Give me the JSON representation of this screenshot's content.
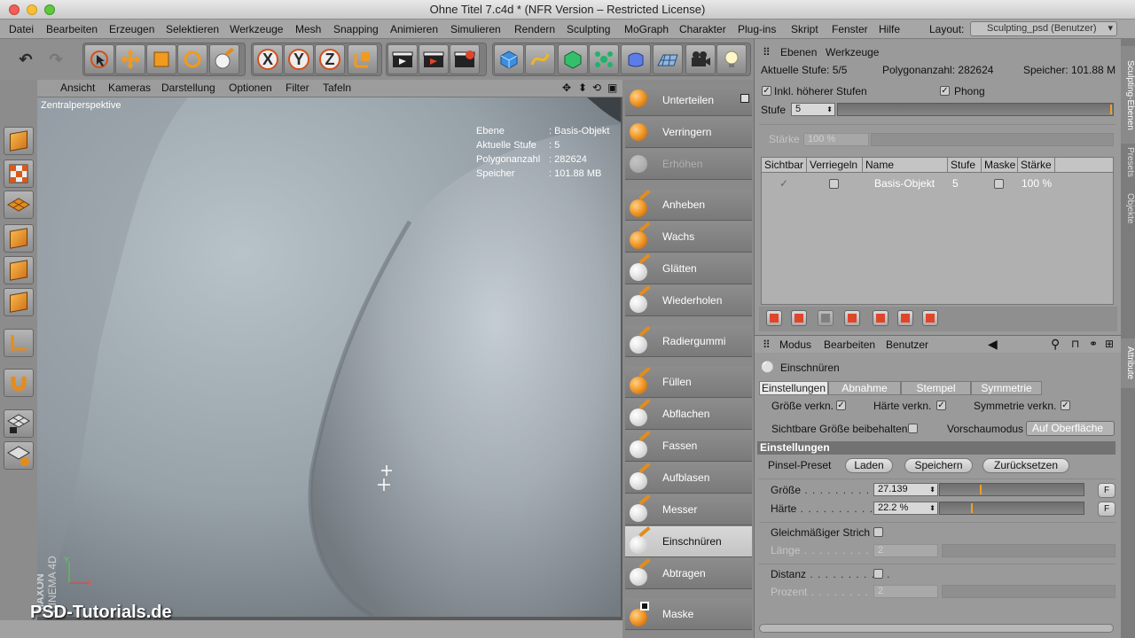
{
  "window": {
    "title": "Ohne Titel 7.c4d * (NFR Version – Restricted License)"
  },
  "menubar": {
    "items": [
      "Datei",
      "Bearbeiten",
      "Erzeugen",
      "Selektieren",
      "Werkzeuge",
      "Mesh",
      "Snapping",
      "Animieren",
      "Simulieren",
      "Rendern",
      "Sculpting",
      "MoGraph",
      "Charakter",
      "Plug-ins",
      "Skript",
      "Fenster",
      "Hilfe"
    ],
    "layout_label": "Layout:",
    "layout_value": "Sculpting_psd (Benutzer)"
  },
  "toolbar": {
    "axis_x": "X",
    "axis_y": "Y",
    "axis_z": "Z"
  },
  "viewport": {
    "menu": [
      "Ansicht",
      "Kameras",
      "Darstellung",
      "Optionen",
      "Filter",
      "Tafeln"
    ],
    "camera_label": "Zentralperspektive",
    "hud": {
      "ebene_k": "Ebene",
      "ebene_v": ": Basis-Objekt",
      "stufe_k": "Aktuelle Stufe",
      "stufe_v": ": 5",
      "poly_k": "Polygonanzahl",
      "poly_v": ": 282624",
      "mem_k": "Speicher",
      "mem_v": ": 101.88 MB"
    },
    "watermark": "PSD-Tutorials.de",
    "brand_1": "MAXON",
    "brand_2": "CINEMA 4D",
    "axis_y": "Y",
    "axis_x": "X"
  },
  "tools": [
    {
      "label": "Unterteilen"
    },
    {
      "label": "Verringern"
    },
    {
      "label": "Erhöhen"
    },
    {
      "label": "Anheben"
    },
    {
      "label": "Wachs"
    },
    {
      "label": "Glätten"
    },
    {
      "label": "Wiederholen"
    },
    {
      "label": "Radiergummi"
    },
    {
      "label": "Füllen"
    },
    {
      "label": "Abflachen"
    },
    {
      "label": "Fassen"
    },
    {
      "label": "Aufblasen"
    },
    {
      "label": "Messer"
    },
    {
      "label": "Einschnüren"
    },
    {
      "label": "Abtragen"
    },
    {
      "label": "Maske"
    }
  ],
  "layers_panel": {
    "tabs": [
      "Ebenen",
      "Werkzeuge"
    ],
    "info_stufe": "Aktuelle Stufe: 5/5",
    "info_poly": "Polygonanzahl: 282624",
    "info_mem": "Speicher: 101.88 M",
    "incl_label": "Inkl. höherer Stufen",
    "phong_label": "Phong",
    "stufe_label": "Stufe",
    "stufe_value": "5",
    "staerke_label": "Stärke",
    "staerke_value": "100 %",
    "columns": [
      "Sichtbar",
      "Verriegeln",
      "Name",
      "Stufe",
      "Maske",
      "Stärke"
    ],
    "row": {
      "name": "Basis-Objekt",
      "stufe": "5",
      "staerke": "100 %"
    }
  },
  "attributes": {
    "menu": [
      "Modus",
      "Bearbeiten",
      "Benutzer"
    ],
    "tool_name": "Einschnüren",
    "tabs": [
      "Einstellungen",
      "Abnahme",
      "Stempel",
      "Symmetrie"
    ],
    "size_press": "Größe verkn.",
    "hard_press": "Härte verkn.",
    "sym_press": "Symmetrie verkn.",
    "keep_size": "Sichtbare Größe beibehalten",
    "preview_label": "Vorschaumodus",
    "preview_value": "Auf Oberfläche",
    "section": "Einstellungen",
    "preset_label": "Pinsel-Preset",
    "load": "Laden",
    "save": "Speichern",
    "reset": "Zurücksetzen",
    "size_label": "Größe",
    "size_value": "27.139",
    "size_level": 0.28,
    "hard_label": "Härte",
    "hard_value": "22.2 %",
    "hard_level": 0.22,
    "stroke_label": "Gleichmäßiger Strich",
    "length_label": "Länge",
    "length_value": "2",
    "dist_label": "Distanz",
    "pct_label": "Prozent",
    "pct_value": "2",
    "f_btn": "F"
  },
  "side_tabs": [
    "Sculpting-Ebenen",
    "Presets",
    "Objekte",
    "Attribute"
  ]
}
